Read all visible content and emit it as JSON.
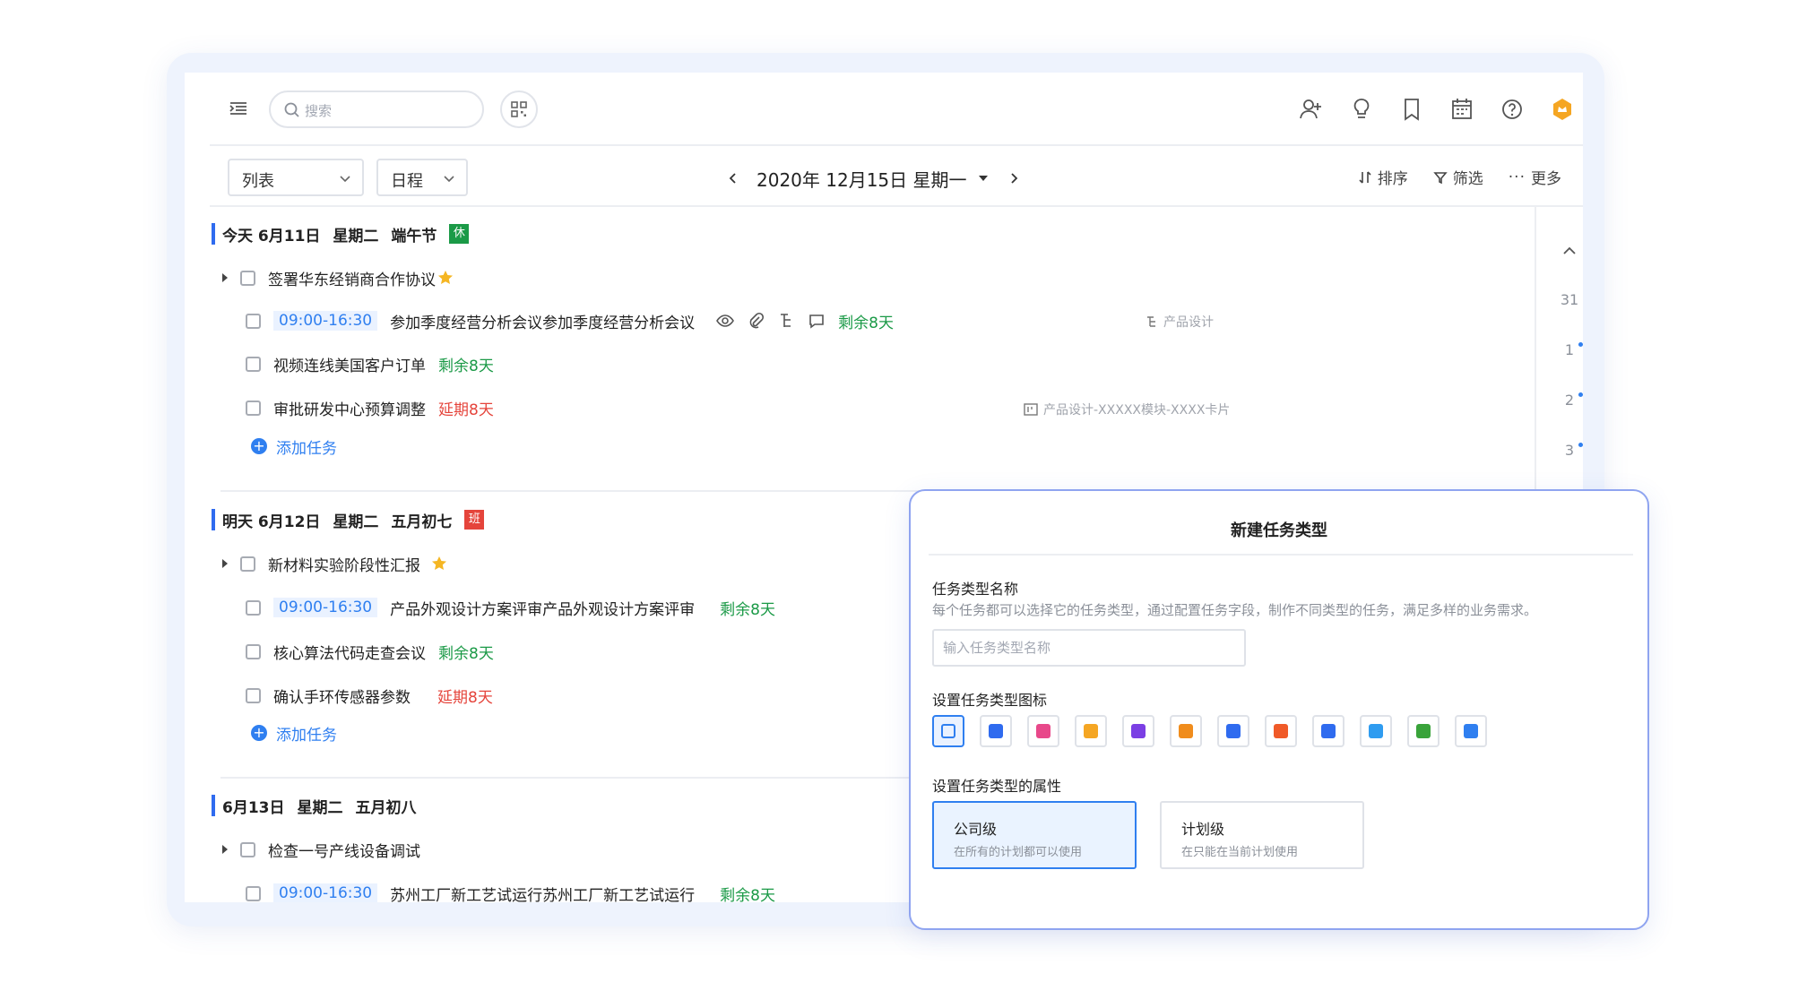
{
  "topbar": {
    "search_placeholder": "搜索"
  },
  "toolbar": {
    "view_select": "列表",
    "mode_select": "日程",
    "date_label": "2020年 12月15日 星期一",
    "sort_label": "排序",
    "filter_label": "筛选",
    "more_label": "更多"
  },
  "days": [
    {
      "header": {
        "date": "今天 6月11日",
        "weekday": "星期二",
        "extra": "端午节",
        "tag": "休",
        "tag_color": "#1b9a47"
      },
      "tasks": [
        {
          "title": "签署华东经销商合作协议"
        },
        {
          "time": "09:00-16:30",
          "title": "参加季度经营分析会议参加季度经营分析会议",
          "status": "剩余8天",
          "right": "产品设计"
        },
        {
          "title": "视频连线美国客户订单",
          "status": "剩余8天"
        },
        {
          "title": "审批研发中心预算调整",
          "status": "延期8天",
          "right": "产品设计-XXXXX模块-XXXX卡片"
        }
      ],
      "add_label": "添加任务"
    },
    {
      "header": {
        "date": "明天 6月12日",
        "weekday": "星期二",
        "extra": "五月初七",
        "tag": "班",
        "tag_color": "#e5443b"
      },
      "tasks": [
        {
          "title": "新材料实验阶段性汇报"
        },
        {
          "time": "09:00-16:30",
          "title": "产品外观设计方案评审产品外观设计方案评审",
          "status": "剩余8天"
        },
        {
          "title": "核心算法代码走查会议",
          "status": "剩余8天"
        },
        {
          "title": "确认手环传感器参数",
          "status": "延期8天"
        }
      ],
      "add_label": "添加任务"
    },
    {
      "header": {
        "date": "6月13日",
        "weekday": "星期二",
        "extra": "五月初八"
      },
      "tasks": [
        {
          "title": "检查一号产线设备调试"
        },
        {
          "time": "09:00-16:30",
          "title": "苏州工厂新工艺试运行苏州工厂新工艺试运行",
          "status": "剩余8天"
        }
      ]
    }
  ],
  "side_calendar": [
    "31",
    "1",
    "2",
    "3"
  ],
  "modal": {
    "title": "新建任务类型",
    "name_label": "任务类型名称",
    "name_desc": "每个任务都可以选择它的任务类型，通过配置任务字段，制作不同类型的任务，满足多样的业务需求。",
    "name_placeholder": "输入任务类型名称",
    "icon_label": "设置任务类型图标",
    "icon_colors": [
      "#2f7ff0",
      "#2f6bef",
      "#e8488a",
      "#f5a623",
      "#7b3fe4",
      "#f08c1c",
      "#2f6bef",
      "#f05a28",
      "#2f6bef",
      "#2f9cf0",
      "#39a33a",
      "#2f7ff0"
    ],
    "attr_label": "设置任务类型的属性",
    "options": [
      {
        "title": "公司级",
        "desc": "在所有的计划都可以使用"
      },
      {
        "title": "计划级",
        "desc": "在只能在当前计划使用"
      }
    ]
  }
}
